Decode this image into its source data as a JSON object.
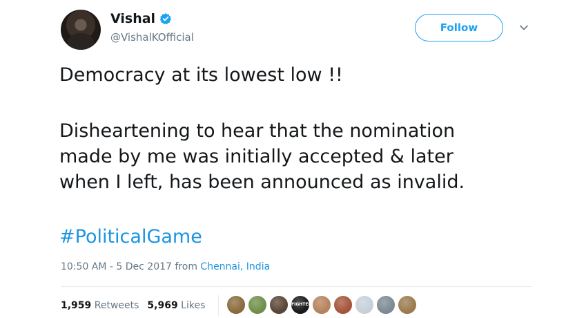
{
  "author": {
    "display_name": "Vishal",
    "handle": "@VishalKOfficial",
    "verified": true,
    "avatar_icon": "profile-photo"
  },
  "follow_label": "Follow",
  "tweet": {
    "line1": "Democracy at its lowest low !!",
    "para2": [
      "Disheartening to hear that the nomination",
      "made by me was initially accepted & later",
      "when I left, has been announced as invalid."
    ],
    "hashtag": "#PoliticalGame"
  },
  "meta": {
    "time_date": "10:50 AM - 5 Dec 2017 from ",
    "location": "Chennai, India"
  },
  "stats": {
    "retweets_count": "1,959",
    "retweets_label": "Retweets",
    "likes_count": "5,969",
    "likes_label": "Likes"
  },
  "likers": [
    {
      "name": "liker-avatar-1",
      "color": "#8a6b3d"
    },
    {
      "name": "liker-avatar-2",
      "color": "#6f8f4a"
    },
    {
      "name": "liker-avatar-3",
      "color": "#5a4636"
    },
    {
      "name": "liker-avatar-fighter",
      "color": "#1a1a1a",
      "text": "FIGHTER"
    },
    {
      "name": "liker-avatar-5",
      "color": "#b5835c"
    },
    {
      "name": "liker-avatar-6",
      "color": "#a6553a"
    },
    {
      "name": "liker-avatar-7",
      "color": "#c7d0d8"
    },
    {
      "name": "liker-avatar-8",
      "color": "#7d8a93"
    },
    {
      "name": "liker-avatar-9",
      "color": "#9b7b4f"
    }
  ],
  "colors": {
    "accent": "#1da1f2",
    "link": "#1b95e0",
    "muted": "#657786",
    "text": "#14171a"
  }
}
